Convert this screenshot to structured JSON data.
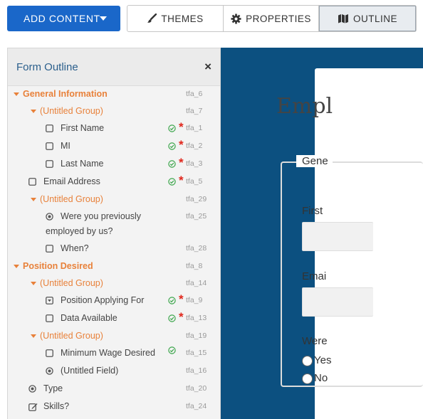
{
  "toolbar": {
    "add_content": "ADD CONTENT",
    "themes": "THEMES",
    "properties": "PROPERTIES",
    "outline": "OUTLINE"
  },
  "panel": {
    "title": "Form Outline",
    "close": "×"
  },
  "outline": [
    {
      "label": "General Information",
      "id": "tfa_6",
      "kind": "section"
    },
    {
      "label": "(Untitled Group)",
      "id": "tfa_7",
      "kind": "group"
    },
    {
      "label": "First Name",
      "id": "tfa_1",
      "kind": "field",
      "icon": "checkbox-icon",
      "valid": true,
      "required": true
    },
    {
      "label": "MI",
      "id": "tfa_2",
      "kind": "field",
      "icon": "checkbox-icon",
      "valid": true,
      "required": true
    },
    {
      "label": "Last Name",
      "id": "tfa_3",
      "kind": "field",
      "icon": "checkbox-icon",
      "valid": true,
      "required": true
    },
    {
      "label": "Email Address",
      "id": "tfa_5",
      "kind": "field",
      "icon": "checkbox-icon",
      "valid": true,
      "required": true
    },
    {
      "label": "(Untitled Group)",
      "id": "tfa_29",
      "kind": "group"
    },
    {
      "label": "Were you previously",
      "label2": "employed by us?",
      "id": "tfa_25",
      "kind": "field",
      "icon": "radio-icon"
    },
    {
      "label": "When?",
      "id": "tfa_28",
      "kind": "field",
      "icon": "checkbox-icon"
    },
    {
      "label": "Position Desired",
      "id": "tfa_8",
      "kind": "section"
    },
    {
      "label": "(Untitled Group)",
      "id": "tfa_14",
      "kind": "group"
    },
    {
      "label": "Position Applying For",
      "id": "tfa_9",
      "kind": "field",
      "icon": "select-icon",
      "valid": true,
      "required": true
    },
    {
      "label": "Data Available",
      "id": "tfa_13",
      "kind": "field",
      "icon": "checkbox-icon",
      "valid": true,
      "required": true
    },
    {
      "label": "(Untitled Group)",
      "id": "tfa_19",
      "kind": "group"
    },
    {
      "label": "Minimum Wage Desired",
      "id": "tfa_15",
      "kind": "field",
      "icon": "checkbox-icon",
      "valid": true
    },
    {
      "label": "(Untitled Field)",
      "id": "tfa_16",
      "kind": "field",
      "icon": "radio-icon"
    },
    {
      "label": "Type",
      "id": "tfa_20",
      "kind": "field",
      "icon": "radio-icon"
    },
    {
      "label": "Skills?",
      "id": "tfa_24",
      "kind": "field",
      "icon": "edit-icon"
    }
  ],
  "preview": {
    "title": "Empl",
    "legend": "Gene",
    "first_label": "First",
    "email_label": "Emai",
    "were_label": "Were",
    "yes_label": "Yes",
    "no_label": "No"
  },
  "colors": {
    "primary": "#1a67c9",
    "section": "#e8813a",
    "preview_bg": "#0c5080",
    "required": "#e0261b",
    "valid": "#3aa54a"
  }
}
